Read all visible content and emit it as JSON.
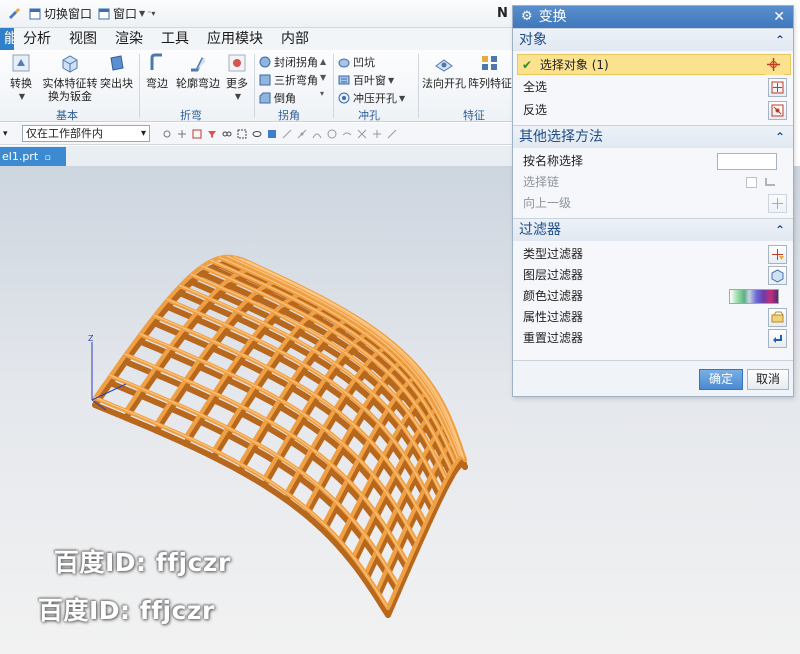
{
  "titlebar": {
    "switch_window": "切换窗口",
    "window_menu": "窗口",
    "right_letter": "N"
  },
  "tabs": [
    {
      "label": "能"
    },
    {
      "label": "分析"
    },
    {
      "label": "视图"
    },
    {
      "label": "渲染"
    },
    {
      "label": "工具"
    },
    {
      "label": "应用模块"
    },
    {
      "label": "内部"
    }
  ],
  "ribbon": {
    "convert": "转换",
    "solid_feature_line1": "实体特征转",
    "solid_feature_line2": "换为钣金",
    "emboss": "突出块",
    "group_basic": "基本",
    "flange": "弯边",
    "contour_flange": "轮廓弯边",
    "more": "更多",
    "group_bend": "折弯",
    "closed_corner": "封闭拐角",
    "three_bend_corner": "三折弯角",
    "chamfer": "倒角",
    "group_corner": "拐角",
    "dimple": "凹坑",
    "louver": "百叶窗",
    "stamp_hole": "冲压开孔",
    "group_punch": "冲孔",
    "normal_cutout": "法向开孔",
    "pattern_feature": "阵列特征",
    "group_feature": "特征"
  },
  "selection_bar": {
    "scope": "仅在工作部件内"
  },
  "document_tab": {
    "name": "el1.prt",
    "close": "×"
  },
  "dialog": {
    "title": "变换",
    "object": {
      "header": "对象",
      "select_object": "选择对象 (1)",
      "select_all": "全选",
      "invert": "反选"
    },
    "other_methods": {
      "header": "其他选择方法",
      "by_name": "按名称选择",
      "chain": "选择链",
      "up_one_level": "向上一级"
    },
    "filters": {
      "header": "过滤器",
      "type_filter": "类型过滤器",
      "layer_filter": "图层过滤器",
      "color_filter": "颜色过滤器",
      "attribute_filter": "属性过滤器",
      "reset_filter": "重置过滤器"
    },
    "ok": "确定",
    "cancel": "取消"
  },
  "viewport": {
    "axis_z": "Z",
    "watermark_1": "百度ID: ffjczr",
    "watermark_2": "百度ID: ffjczr"
  },
  "colors": {
    "accent": "#3f77bd",
    "model_orange": "#f0a044",
    "selected_row": "#fbe28e"
  }
}
